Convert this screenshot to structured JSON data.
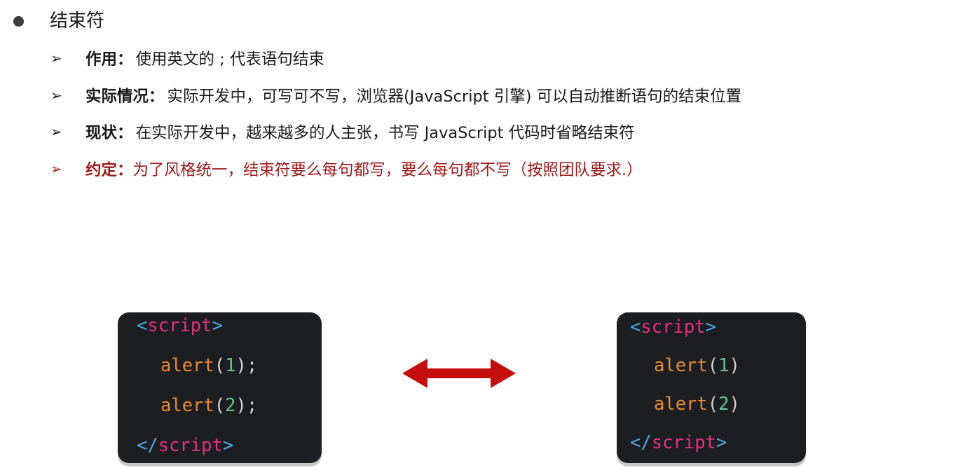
{
  "heading": "结束符",
  "points": [
    {
      "label": "作用：",
      "text": "使用英文的 ; 代表语句结束",
      "highlight": false
    },
    {
      "label": "实际情况：",
      "text": "实际开发中，可写可不写，浏览器(JavaScript 引擎) 可以自动推断语句的结束位置",
      "highlight": false
    },
    {
      "label": "现状：",
      "text": "在实际开发中，越来越多的人主张，书写 JavaScript 代码时省略结束符",
      "highlight": false
    },
    {
      "label": "约定：",
      "text": "为了风格统一，结束符要么每句都写，要么每句都不写（按照团队要求.）",
      "highlight": true
    }
  ],
  "code_left": {
    "open_tag": {
      "lt": "<",
      "name": "script",
      "gt": ">"
    },
    "lines": [
      {
        "fn": "alert",
        "open": "(",
        "arg": "1",
        "close": ")",
        "end": ";"
      },
      {
        "fn": "alert",
        "open": "(",
        "arg": "2",
        "close": ")",
        "end": ";"
      }
    ],
    "close_tag": {
      "lt": "</",
      "name": "script",
      "gt": ">"
    }
  },
  "code_right": {
    "open_tag": {
      "lt": "<",
      "name": "script",
      "gt": ">"
    },
    "lines": [
      {
        "fn": "alert",
        "open": "(",
        "arg": "1",
        "close": ")",
        "end": ""
      },
      {
        "fn": "alert",
        "open": "(",
        "arg": "2",
        "close": ")",
        "end": ""
      }
    ],
    "close_tag": {
      "lt": "</",
      "name": "script",
      "gt": ">"
    }
  },
  "colors": {
    "highlight": "#9c1a1a",
    "code_bg": "#1d1e21",
    "arrow": "#c40e0e"
  },
  "icons": {
    "bullet": "bullet-dot",
    "point_marker": "arrowhead-bullet-icon",
    "equivalence": "double-headed-arrow-icon"
  }
}
